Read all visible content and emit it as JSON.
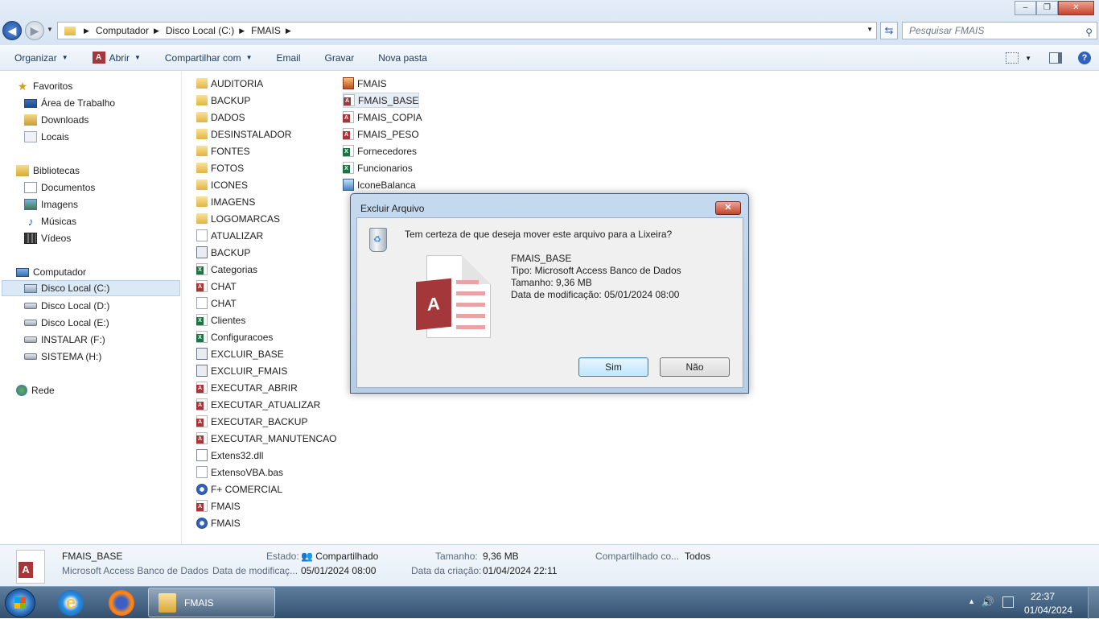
{
  "window": {
    "controls": [
      "–",
      "❐",
      "✕"
    ]
  },
  "address": {
    "crumbs": [
      "Computador",
      "Disco Local (C:)",
      "FMAIS"
    ],
    "search_placeholder": "Pesquisar FMAIS"
  },
  "toolbar": {
    "organize": "Organizar",
    "open": "Abrir",
    "share": "Compartilhar com",
    "email": "Email",
    "burn": "Gravar",
    "new_folder": "Nova pasta"
  },
  "sidebar": {
    "favorites": "Favoritos",
    "desktop": "Área de Trabalho",
    "downloads": "Downloads",
    "places": "Locais",
    "libraries": "Bibliotecas",
    "documents": "Documentos",
    "images": "Imagens",
    "music": "Músicas",
    "videos": "Vídeos",
    "computer": "Computador",
    "drive_c": "Disco Local (C:)",
    "drive_d": "Disco Local (D:)",
    "drive_e": "Disco Local (E:)",
    "drive_f": "INSTALAR (F:)",
    "drive_h": "SISTEMA (H:)",
    "network": "Rede"
  },
  "files_col1": [
    {
      "name": "AUDITORIA",
      "type": "folder"
    },
    {
      "name": "BACKUP",
      "type": "folder"
    },
    {
      "name": "DADOS",
      "type": "folder"
    },
    {
      "name": "DESINSTALADOR",
      "type": "folder"
    },
    {
      "name": "FONTES",
      "type": "folder"
    },
    {
      "name": "FOTOS",
      "type": "folder"
    },
    {
      "name": "ICONES",
      "type": "folder"
    },
    {
      "name": "IMAGENS",
      "type": "folder"
    },
    {
      "name": "LOGOMARCAS",
      "type": "folder"
    },
    {
      "name": "ATUALIZAR",
      "type": "blank"
    },
    {
      "name": "BACKUP",
      "type": "script"
    },
    {
      "name": "Categorias",
      "type": "xls"
    },
    {
      "name": "CHAT",
      "type": "acc"
    },
    {
      "name": "CHAT",
      "type": "blank"
    },
    {
      "name": "Clientes",
      "type": "xls"
    },
    {
      "name": "Configuracoes",
      "type": "xls"
    },
    {
      "name": "EXCLUIR_BASE",
      "type": "script"
    },
    {
      "name": "EXCLUIR_FMAIS",
      "type": "script"
    },
    {
      "name": "EXECUTAR_ABRIR",
      "type": "acc"
    },
    {
      "name": "EXECUTAR_ATUALIZAR",
      "type": "acc"
    },
    {
      "name": "EXECUTAR_BACKUP",
      "type": "acc"
    },
    {
      "name": "EXECUTAR_MANUTENCAO",
      "type": "acc"
    },
    {
      "name": "Extens32.dll",
      "type": "exe"
    },
    {
      "name": "ExtensoVBA.bas",
      "type": "blank"
    },
    {
      "name": "F+ COMERCIAL",
      "type": "app"
    },
    {
      "name": "FMAIS",
      "type": "acc"
    },
    {
      "name": "FMAIS",
      "type": "app"
    }
  ],
  "files_col2": [
    {
      "name": "FMAIS",
      "type": "mdb"
    },
    {
      "name": "FMAIS_BASE",
      "type": "acc"
    },
    {
      "name": "FMAIS_COPIA",
      "type": "acc"
    },
    {
      "name": "FMAIS_PESO",
      "type": "acc"
    },
    {
      "name": "Fornecedores",
      "type": "xls"
    },
    {
      "name": "Funcionarios",
      "type": "xls"
    },
    {
      "name": "IconeBalanca",
      "type": "ico"
    }
  ],
  "details": {
    "name": "FMAIS_BASE",
    "type": "Microsoft Access Banco de Dados",
    "state_label": "Estado:",
    "state_value": "Compartilhado",
    "modified_label": "Data de modificaç...",
    "modified_value": "05/01/2024 08:00",
    "size_label": "Tamanho:",
    "size_value": "9,36 MB",
    "created_label": "Data da criação:",
    "created_value": "01/04/2024 22:11",
    "shared_label": "Compartilhado co...",
    "shared_value": "Todos"
  },
  "dialog": {
    "title": "Excluir Arquivo",
    "question": "Tem certeza de que deseja mover este arquivo para a Lixeira?",
    "file_name": "FMAIS_BASE",
    "file_type": "Tipo: Microsoft Access Banco de Dados",
    "file_size": "Tamanho: 9,36 MB",
    "file_date": "Data de modificação: 05/01/2024 08:00",
    "yes": "Sim",
    "no": "Não"
  },
  "taskbar": {
    "task_label": "FMAIS",
    "time": "22:37",
    "date": "01/04/2024"
  },
  "colors": {
    "access_red": "#a4373a",
    "excel_green": "#1f7244",
    "folder_yellow": "#e2b441"
  }
}
